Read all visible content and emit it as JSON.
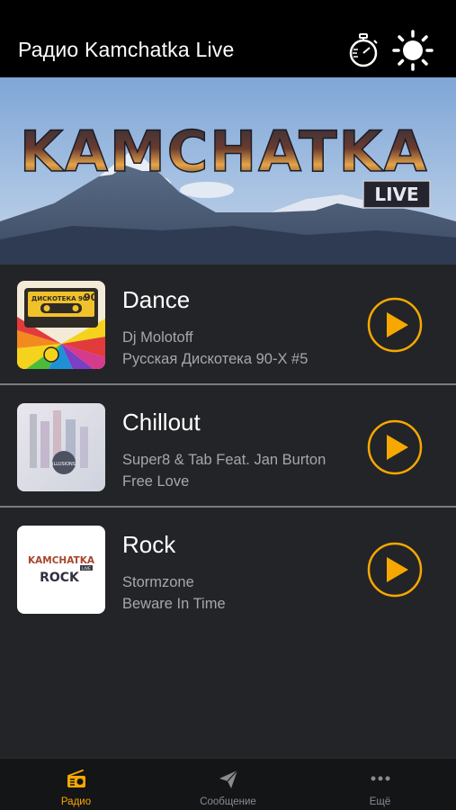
{
  "header": {
    "title": "Радио Kamchatka Live",
    "timer_icon": "stopwatch-icon",
    "theme_icon": "sun-icon"
  },
  "banner": {
    "logo_text": "KAMCHATKA",
    "logo_badge": "LIVE"
  },
  "stations": [
    {
      "name": "Dance",
      "artist": "Dj Molotoff",
      "track": "Русская Дискотека 90-Х #5",
      "cover_text": "ДИСКОТЕКА 90",
      "cover_badge": "90"
    },
    {
      "name": "Chillout",
      "artist": "Super8 & Tab Feat. Jan Burton",
      "track": "Free Love",
      "cover_text": "ILLUSIONS"
    },
    {
      "name": "Rock",
      "artist": "Stormzone",
      "track": "Beware In Time",
      "cover_text": "KAMCHATKA",
      "cover_text2": "ROCK",
      "cover_badge": "LIVE"
    }
  ],
  "tabs": [
    {
      "label": "Радио",
      "icon": "radio-icon",
      "active": true
    },
    {
      "label": "Сообщение",
      "icon": "paper-plane-icon",
      "active": false
    },
    {
      "label": "Ещё",
      "icon": "more-dots-icon",
      "active": false
    }
  ],
  "colors": {
    "accent": "#f6a800",
    "background": "#232427",
    "header": "#000000",
    "secondary_text": "#a6a7ab"
  }
}
